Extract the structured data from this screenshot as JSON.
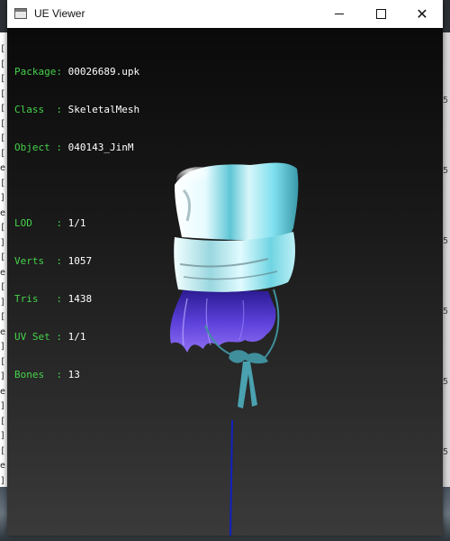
{
  "window": {
    "title": "UE Viewer"
  },
  "mesh_info": {
    "package_key": "Package",
    "package_value": "00026689.upk",
    "class_key": "Class  ",
    "class_value": "SkeletalMesh",
    "object_key": "Object ",
    "object_value": "040143_JinM",
    "lod_key": "LOD    ",
    "lod_value": "1/1",
    "verts_key": "Verts  ",
    "verts_value": "1057",
    "tris_key": "Tris   ",
    "tris_value": "1438",
    "uvset_key": "UV Set ",
    "uvset_value": "1/1",
    "bones_key": "Bones  ",
    "bones_value": "13",
    "separator": ": "
  },
  "colors": {
    "key_text": "#45d24a",
    "value_text": "#ffffff",
    "hat_cyan": "#7fe0ee",
    "hair_purple": "#5a3fd8",
    "ribbon_teal": "#3f8f9c",
    "bone_line": "#1020c0"
  },
  "icons": {
    "app": "window-app-icon",
    "minimize": "minimize-icon",
    "maximize": "maximize-icon",
    "close": "close-icon"
  },
  "background_window": {
    "left_glyphs": [
      "[",
      "[",
      "[",
      "[",
      "[",
      "[",
      "[",
      "[",
      "e",
      "[",
      "]",
      "e",
      "[",
      "]",
      "[",
      "e",
      "[",
      "]",
      "[",
      "e",
      "]",
      "[",
      "]",
      "e",
      "]",
      "[",
      "]",
      "[",
      "e",
      "]",
      "[",
      "e",
      "]"
    ],
    "right_glyphs": [
      "5",
      "5",
      "5",
      "5",
      "5",
      "5"
    ]
  }
}
